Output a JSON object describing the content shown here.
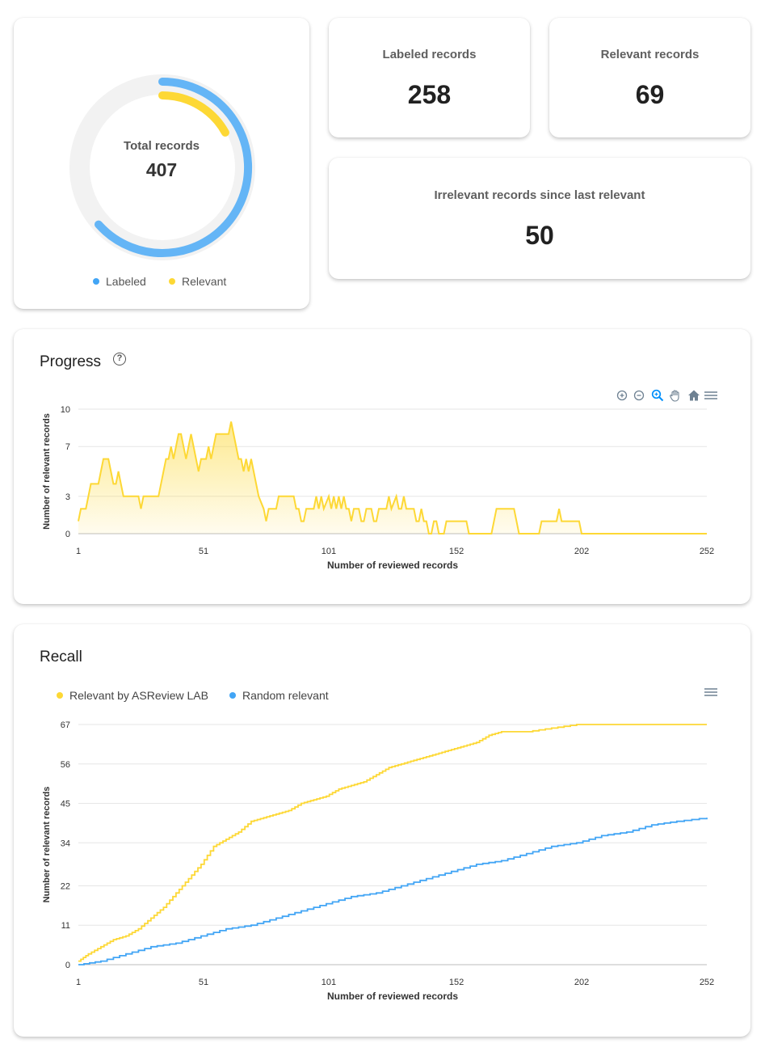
{
  "summary": {
    "total_label": "Total records",
    "total_value": "407",
    "legend": [
      {
        "label": "Labeled",
        "color": "#42a5f5"
      },
      {
        "label": "Relevant",
        "color": "#fdd835"
      }
    ]
  },
  "labeled": {
    "label": "Labeled records",
    "value": "258"
  },
  "relevant": {
    "label": "Relevant records",
    "value": "69"
  },
  "irrelevant": {
    "label": "Irrelevant records since last relevant",
    "value": "50"
  },
  "progress": {
    "title": "Progress",
    "help_icon": "help-circle-icon",
    "toolbar_icons": [
      "zoom-in-icon",
      "zoom-out-icon",
      "selection-zoom-icon",
      "pan-icon",
      "reset-home-icon",
      "menu-icon"
    ]
  },
  "recall": {
    "title": "Recall",
    "menu_icon": "menu-icon"
  },
  "colors": {
    "labeled": "#42a5f5",
    "relevant": "#fdd835",
    "track": "#f2f2f2"
  },
  "chart_data": [
    {
      "type": "area",
      "ylabel": "Number of relevant records",
      "xlabel": "Number of reviewed records",
      "xlim": [
        1,
        252
      ],
      "ylim": [
        0,
        10
      ],
      "x_ticks": [
        "1",
        "51",
        "101",
        "152",
        "202",
        "252"
      ],
      "y_ticks": [
        "0",
        "3",
        "7",
        "10"
      ],
      "grid": true,
      "series": [
        {
          "color": "#fdd835",
          "points": [
            [
              1,
              1
            ],
            [
              2,
              2
            ],
            [
              4,
              2
            ],
            [
              5,
              3
            ],
            [
              6,
              4
            ],
            [
              9,
              4
            ],
            [
              10,
              5
            ],
            [
              11,
              6
            ],
            [
              13,
              6
            ],
            [
              14,
              5
            ],
            [
              15,
              4
            ],
            [
              16,
              4
            ],
            [
              17,
              5
            ],
            [
              18,
              4
            ],
            [
              19,
              3
            ],
            [
              25,
              3
            ],
            [
              26,
              2
            ],
            [
              27,
              3
            ],
            [
              33,
              3
            ],
            [
              34,
              4
            ],
            [
              35,
              5
            ],
            [
              36,
              6
            ],
            [
              37,
              6
            ],
            [
              38,
              7
            ],
            [
              39,
              6
            ],
            [
              40,
              7
            ],
            [
              41,
              8
            ],
            [
              42,
              8
            ],
            [
              43,
              7
            ],
            [
              44,
              6
            ],
            [
              45,
              7
            ],
            [
              46,
              8
            ],
            [
              47,
              7
            ],
            [
              48,
              6
            ],
            [
              49,
              5
            ],
            [
              50,
              6
            ],
            [
              52,
              6
            ],
            [
              53,
              7
            ],
            [
              54,
              6
            ],
            [
              55,
              7
            ],
            [
              56,
              8
            ],
            [
              61,
              8
            ],
            [
              62,
              9
            ],
            [
              63,
              8
            ],
            [
              64,
              7
            ],
            [
              65,
              6
            ],
            [
              66,
              6
            ],
            [
              67,
              5
            ],
            [
              68,
              6
            ],
            [
              69,
              5
            ],
            [
              70,
              6
            ],
            [
              71,
              5
            ],
            [
              72,
              4
            ],
            [
              73,
              3
            ],
            [
              75,
              2
            ],
            [
              76,
              1
            ],
            [
              77,
              2
            ],
            [
              80,
              2
            ],
            [
              81,
              3
            ],
            [
              87,
              3
            ],
            [
              88,
              2
            ],
            [
              89,
              2
            ],
            [
              90,
              1
            ],
            [
              91,
              1
            ],
            [
              92,
              2
            ],
            [
              95,
              2
            ],
            [
              96,
              3
            ],
            [
              97,
              2
            ],
            [
              98,
              3
            ],
            [
              99,
              2
            ],
            [
              101,
              3
            ],
            [
              102,
              2
            ],
            [
              103,
              3
            ],
            [
              104,
              2
            ],
            [
              105,
              3
            ],
            [
              106,
              2
            ],
            [
              107,
              3
            ],
            [
              108,
              2
            ],
            [
              109,
              2
            ],
            [
              110,
              1
            ],
            [
              111,
              2
            ],
            [
              113,
              2
            ],
            [
              114,
              1
            ],
            [
              115,
              1
            ],
            [
              116,
              2
            ],
            [
              118,
              2
            ],
            [
              119,
              1
            ],
            [
              120,
              1
            ],
            [
              121,
              2
            ],
            [
              124,
              2
            ],
            [
              125,
              3
            ],
            [
              126,
              2
            ],
            [
              128,
              3
            ],
            [
              129,
              2
            ],
            [
              130,
              2
            ],
            [
              131,
              3
            ],
            [
              132,
              2
            ],
            [
              135,
              2
            ],
            [
              136,
              1
            ],
            [
              137,
              1
            ],
            [
              138,
              2
            ],
            [
              139,
              1
            ],
            [
              140,
              1
            ],
            [
              141,
              0
            ],
            [
              142,
              0
            ],
            [
              143,
              1
            ],
            [
              144,
              1
            ],
            [
              145,
              0
            ],
            [
              147,
              0
            ],
            [
              148,
              1
            ],
            [
              156,
              1
            ],
            [
              157,
              0
            ],
            [
              166,
              0
            ],
            [
              167,
              1
            ],
            [
              168,
              2
            ],
            [
              175,
              2
            ],
            [
              176,
              1
            ],
            [
              177,
              0
            ],
            [
              185,
              0
            ],
            [
              186,
              1
            ],
            [
              192,
              1
            ],
            [
              193,
              2
            ],
            [
              194,
              1
            ],
            [
              201,
              1
            ],
            [
              202,
              0
            ],
            [
              252,
              0
            ]
          ]
        }
      ]
    },
    {
      "type": "line",
      "ylabel": "Number of relevant records",
      "xlabel": "Number of reviewed records",
      "xlim": [
        1,
        252
      ],
      "ylim": [
        0,
        67
      ],
      "x_ticks": [
        "1",
        "51",
        "101",
        "152",
        "202",
        "252"
      ],
      "y_ticks": [
        "0",
        "11",
        "22",
        "34",
        "45",
        "56",
        "67"
      ],
      "grid": true,
      "legend_position": "top-left",
      "series": [
        {
          "name": "Relevant by ASReview LAB",
          "color": "#fdd835",
          "points": [
            [
              1,
              1
            ],
            [
              5,
              3
            ],
            [
              10,
              5
            ],
            [
              15,
              7
            ],
            [
              20,
              8
            ],
            [
              25,
              10
            ],
            [
              30,
              13
            ],
            [
              35,
              16
            ],
            [
              40,
              20
            ],
            [
              45,
              24
            ],
            [
              50,
              28
            ],
            [
              55,
              33
            ],
            [
              60,
              35
            ],
            [
              65,
              37
            ],
            [
              70,
              40
            ],
            [
              75,
              41
            ],
            [
              80,
              42
            ],
            [
              85,
              43
            ],
            [
              90,
              45
            ],
            [
              95,
              46
            ],
            [
              100,
              47
            ],
            [
              105,
              49
            ],
            [
              110,
              50
            ],
            [
              115,
              51
            ],
            [
              120,
              53
            ],
            [
              125,
              55
            ],
            [
              130,
              56
            ],
            [
              135,
              57
            ],
            [
              140,
              58
            ],
            [
              145,
              59
            ],
            [
              150,
              60
            ],
            [
              155,
              61
            ],
            [
              160,
              62
            ],
            [
              165,
              64
            ],
            [
              170,
              65
            ],
            [
              180,
              65
            ],
            [
              190,
              66
            ],
            [
              200,
              67
            ],
            [
              252,
              67
            ]
          ]
        },
        {
          "name": "Random relevant",
          "color": "#42a5f5",
          "points": [
            [
              1,
              0
            ],
            [
              10,
              1
            ],
            [
              20,
              3
            ],
            [
              30,
              5
            ],
            [
              40,
              6
            ],
            [
              50,
              8
            ],
            [
              60,
              10
            ],
            [
              70,
              11
            ],
            [
              80,
              13
            ],
            [
              90,
              15
            ],
            [
              100,
              17
            ],
            [
              110,
              19
            ],
            [
              120,
              20
            ],
            [
              130,
              22
            ],
            [
              140,
              24
            ],
            [
              150,
              26
            ],
            [
              160,
              28
            ],
            [
              170,
              29
            ],
            [
              180,
              31
            ],
            [
              190,
              33
            ],
            [
              200,
              34
            ],
            [
              210,
              36
            ],
            [
              220,
              37
            ],
            [
              230,
              39
            ],
            [
              240,
              40
            ],
            [
              252,
              41
            ]
          ]
        }
      ]
    }
  ]
}
